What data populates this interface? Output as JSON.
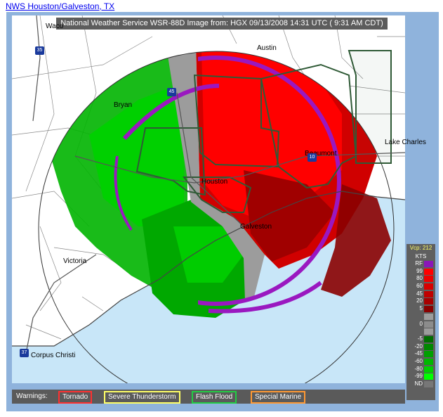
{
  "link_text": "NWS Houston/Galveston, TX",
  "header_text": "National Weather Service WSR-88D Image from: HGX 09/13/2008 14:31 UTC ( 9:31 AM CDT)",
  "cities": [
    "Bryan",
    "Austin",
    "Houston",
    "Galveston",
    "Beaumont",
    "Lake Charles",
    "Victoria",
    "Corpus Christi",
    "Waco"
  ],
  "highway_shields": [
    "35",
    "45",
    "10",
    "37"
  ],
  "legend": {
    "vcp": "Vcp: 212",
    "units": "KTS",
    "scale": [
      {
        "label": "RF",
        "color": "#8b16b8"
      },
      {
        "label": "99",
        "color": "#ff0000"
      },
      {
        "label": "80",
        "color": "#ee0000"
      },
      {
        "label": "60",
        "color": "#d80000"
      },
      {
        "label": "45",
        "color": "#c00000"
      },
      {
        "label": "20",
        "color": "#a80000"
      },
      {
        "label": "5",
        "color": "#8a0000"
      },
      {
        "label": "",
        "color": "#9c9c9c"
      },
      {
        "label": "0",
        "color": "#8c8c8c"
      },
      {
        "label": "",
        "color": "#9c9c9c"
      },
      {
        "label": "-5",
        "color": "#006e00"
      },
      {
        "label": "-20",
        "color": "#008800"
      },
      {
        "label": "-45",
        "color": "#00a000"
      },
      {
        "label": "-60",
        "color": "#00b800"
      },
      {
        "label": "-80",
        "color": "#00d000"
      },
      {
        "label": "-99",
        "color": "#00ff00"
      },
      {
        "label": "ND",
        "color": "#777777"
      }
    ]
  },
  "warnings": {
    "label": "Warnings:",
    "items": [
      {
        "label": "Tornado",
        "color": "#ff3030"
      },
      {
        "label": "Severe Thunderstorm",
        "color": "#ffff66"
      },
      {
        "label": "Flash Flood",
        "color": "#22cc44"
      },
      {
        "label": "Special Marine",
        "color": "#ff9933"
      }
    ]
  }
}
